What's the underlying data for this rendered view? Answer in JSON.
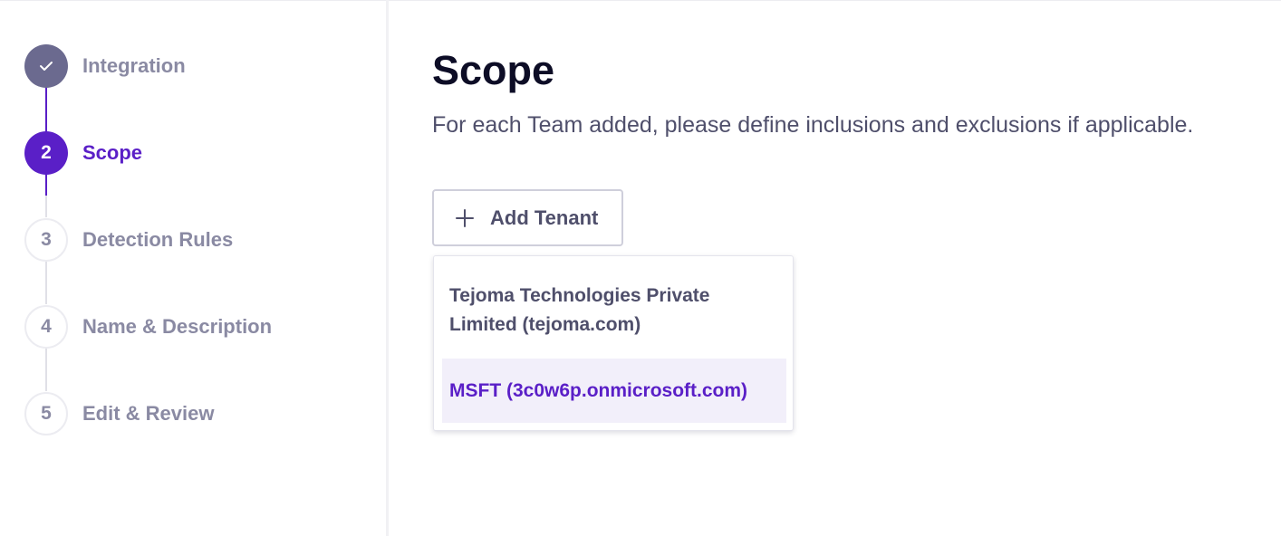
{
  "stepper": {
    "steps": [
      {
        "number": "",
        "label": "Integration",
        "state": "done"
      },
      {
        "number": "2",
        "label": "Scope",
        "state": "active"
      },
      {
        "number": "3",
        "label": "Detection Rules",
        "state": "pending"
      },
      {
        "number": "4",
        "label": "Name & Description",
        "state": "pending"
      },
      {
        "number": "5",
        "label": "Edit & Review",
        "state": "pending"
      }
    ]
  },
  "main": {
    "title": "Scope",
    "subtitle": "For each Team added, please define inclusions and exclusions if applicable.",
    "add_button_label": "Add Tenant",
    "dropdown_options": [
      "Tejoma Technologies Private Limited (tejoma.com)",
      "MSFT (3c0w6p.onmicrosoft.com)"
    ],
    "highlighted_option_index": 1
  },
  "colors": {
    "accent": "#5a1fc7",
    "done_step": "#6b6a8f",
    "muted_text": "#8a8aa3",
    "highlight_bg": "#f2effa"
  },
  "icons": {
    "done_step": "checkmark-icon",
    "add_button": "plus-icon"
  }
}
